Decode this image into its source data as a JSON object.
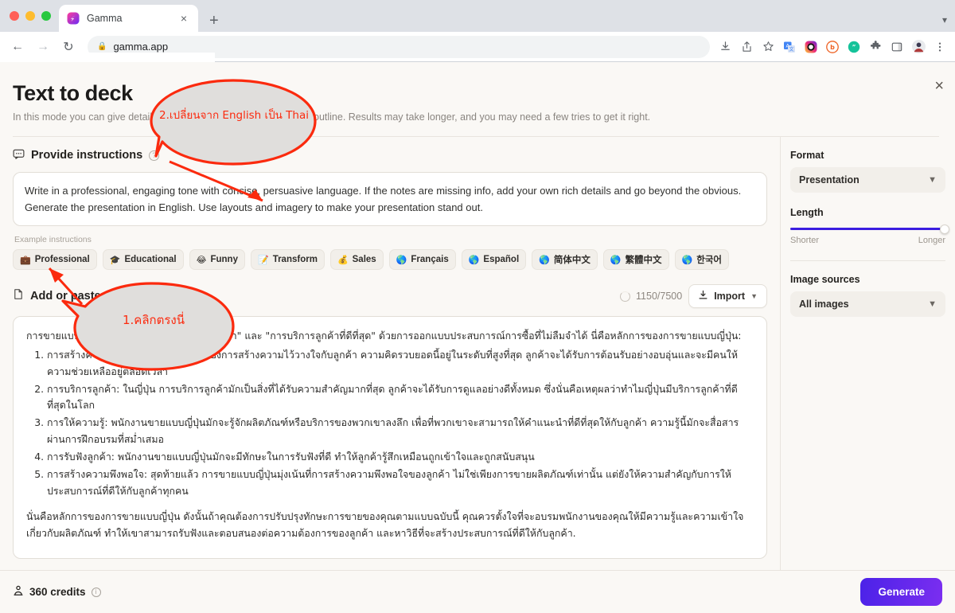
{
  "browser": {
    "tab": {
      "title": "Gamma",
      "close_label": "×"
    },
    "newtab_label": "+",
    "nav": {
      "back": "←",
      "forward": "→",
      "reload": "↻"
    },
    "omnibox": {
      "url": "gamma.app",
      "lock_icon": "lock-icon"
    },
    "toolbar_icons": [
      "downloads-icon",
      "share-icon",
      "bookmark-star-icon",
      "translate-icon",
      "instagram-icon",
      "bitly-icon",
      "grammarly-icon",
      "extensions-puzzle-icon",
      "side-panel-icon",
      "profile-avatar-icon",
      "chrome-menu-icon"
    ]
  },
  "modal": {
    "close_label": "×",
    "title": "Text to deck",
    "subtitle": "In this mode you can give detailed instructions and paste in your full outline. Results may take longer, and you may need a few tries to get it right.",
    "instructions_section": {
      "icon": "chat-bubble-icon",
      "title": "Provide instructions",
      "help_icon": "question-mark-icon",
      "value": "Write in a professional, engaging tone with concise, persuasive language. If the notes are missing info, add your own rich details and go beyond the obvious. Generate the presentation in English. Use layouts and imagery to make your presentation stand out.",
      "examples_label": "Example instructions",
      "chips": [
        {
          "emoji": "💼",
          "label": "Professional"
        },
        {
          "emoji": "🎓",
          "label": "Educational"
        },
        {
          "emoji": "😂",
          "label": "Funny"
        },
        {
          "emoji": "📝",
          "label": "Transform"
        },
        {
          "emoji": "💰",
          "label": "Sales"
        },
        {
          "emoji": "🌎",
          "label": "Français"
        },
        {
          "emoji": "🌎",
          "label": "Español"
        },
        {
          "emoji": "🌎",
          "label": "简体中文"
        },
        {
          "emoji": "🌎",
          "label": "繁體中文"
        },
        {
          "emoji": "🌎",
          "label": "한국어"
        }
      ]
    },
    "content_section": {
      "icon": "document-icon",
      "title": "Add or paste content",
      "char_count": "1150/7500",
      "import_label": "Import",
      "import_icon": "import-download-icon",
      "import_chevron": "chevron-down-icon",
      "editor": {
        "intro": "การขายแบบญี่ปุ่นมีหลักการที่ว่า \"ลูกค้าคือพระเจ้า\" และ \"การบริการลูกค้าที่ดีที่สุด\" ด้วยการออกแบบประสบการณ์การซื้อที่ไม่ลืมจำได้ นี่คือหลักการของการขายแบบญี่ปุ่น:",
        "items": [
          "การสร้างความไว้วางใจ: ความสำคัญของการสร้างความไว้วางใจกับลูกค้า ความคิดรวบยอดนี้อยู่ในระดับที่สูงที่สุด ลูกค้าจะได้รับการต้อนรับอย่างอบอุ่นและจะมีคนให้ความช่วยเหลืออยู่ตลอดเวลา",
          "การบริการลูกค้า: ในญี่ปุ่น การบริการลูกค้ามักเป็นสิ่งที่ได้รับความสำคัญมากที่สุด ลูกค้าจะได้รับการดูแลอย่างดีทั้งหมด ซึ่งนั่นคือเหตุผลว่าทำไมญี่ปุ่นมีบริการลูกค้าที่ดีที่สุดในโลก",
          "การให้ความรู้: พนักงานขายแบบญี่ปุ่นมักจะรู้จักผลิตภัณฑ์หรือบริการของพวกเขาลงลึก เพื่อที่พวกเขาจะสามารถให้คำแนะนำที่ดีที่สุดให้กับลูกค้า ความรู้นี้มักจะสื่อสารผ่านการฝึกอบรมที่สม่ำเสมอ",
          "การรับฟังลูกค้า: พนักงานขายแบบญี่ปุ่นมักจะมีทักษะในการรับฟังที่ดี ทำให้ลูกค้ารู้สึกเหมือนถูกเข้าใจและถูกสนับสนุน",
          "การสร้างความพึงพอใจ: สุดท้ายแล้ว การขายแบบญี่ปุ่นมุ่งเน้นที่การสร้างความพึงพอใจของลูกค้า ไม่ใช่เพียงการขายผลิตภัณฑ์เท่านั้น แต่ยังให้ความสำคัญกับการให้ประสบการณ์ที่ดีให้กับลูกค้าทุกคน"
        ],
        "tail": "นั่นคือหลักการของการขายแบบญี่ปุ่น ดังนั้นถ้าคุณต้องการปรับปรุงทักษะการขายของคุณตามแบบฉบับนี้ คุณควรตั้งใจที่จะอบรมพนักงานของคุณให้มีความรู้และความเข้าใจเกี่ยวกับผลิตภัณฑ์ ทำให้เขาสามารถรับฟังและตอบสนองต่อความต้องการของลูกค้า และหาวิธีที่จะสร้างประสบการณ์ที่ดีให้กับลูกค้า."
      }
    },
    "sidebar": {
      "format_label": "Format",
      "format_value": "Presentation",
      "length_label": "Length",
      "length_shorter": "Shorter",
      "length_longer": "Longer",
      "length_percent": 100,
      "image_sources_label": "Image sources",
      "image_sources_value": "All images",
      "chevron_icon": "chevron-down-icon"
    },
    "footer": {
      "credits_icon": "credits-person-icon",
      "credits_label": "360 credits",
      "info_icon": "info-icon",
      "generate_label": "Generate"
    }
  },
  "annotations": [
    {
      "id": "step2",
      "text": "2.เปลี่ยนจาก English เป็น Thai",
      "color": "#fb2a0e"
    },
    {
      "id": "step1",
      "text": "1.คลิกตรงนี่",
      "color": "#fb2a0e"
    }
  ],
  "colors": {
    "accent": "#3b1de0",
    "generate_gradient_from": "#4b22e8",
    "generate_gradient_to": "#7b2ef0",
    "annotation_red": "#fb2a0e",
    "page_bg": "#faf8f5"
  }
}
